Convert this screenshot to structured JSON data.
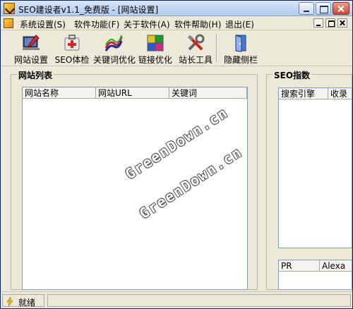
{
  "window": {
    "title": "SEO建设者v1.1_免费版 - [网站设置]"
  },
  "menu": {
    "items": [
      {
        "label": "系统设置(S)"
      },
      {
        "label": "软件功能(F)"
      },
      {
        "label": "关于软件(A)"
      },
      {
        "label": "软件帮助(H)"
      },
      {
        "label": "退出(E)"
      }
    ]
  },
  "toolbar": {
    "items": [
      {
        "label": "网站设置",
        "icon": "website-settings-icon"
      },
      {
        "label": "SEO体检",
        "icon": "first-aid-kit-icon"
      },
      {
        "label": "关键词优化",
        "icon": "chart-lines-icon"
      },
      {
        "label": "链接优化",
        "icon": "link-puzzle-icon"
      },
      {
        "label": "站长工具",
        "icon": "tools-icon"
      },
      {
        "label": "隐藏侧栏",
        "icon": "door-exit-icon"
      }
    ]
  },
  "site_list": {
    "title": "网站列表",
    "columns": [
      "网站名称",
      "网站URL",
      "关键词"
    ]
  },
  "seo_index": {
    "title": "SEO指数",
    "engine_columns": [
      "搜索引擎",
      "收录"
    ],
    "rank_columns": [
      "PR",
      "Alexa"
    ]
  },
  "watermark": {
    "text": "GreenDown.cn"
  },
  "status": {
    "text": "就绪"
  },
  "colors": {
    "accent": "#0a246a",
    "face": "#ece9d8"
  }
}
